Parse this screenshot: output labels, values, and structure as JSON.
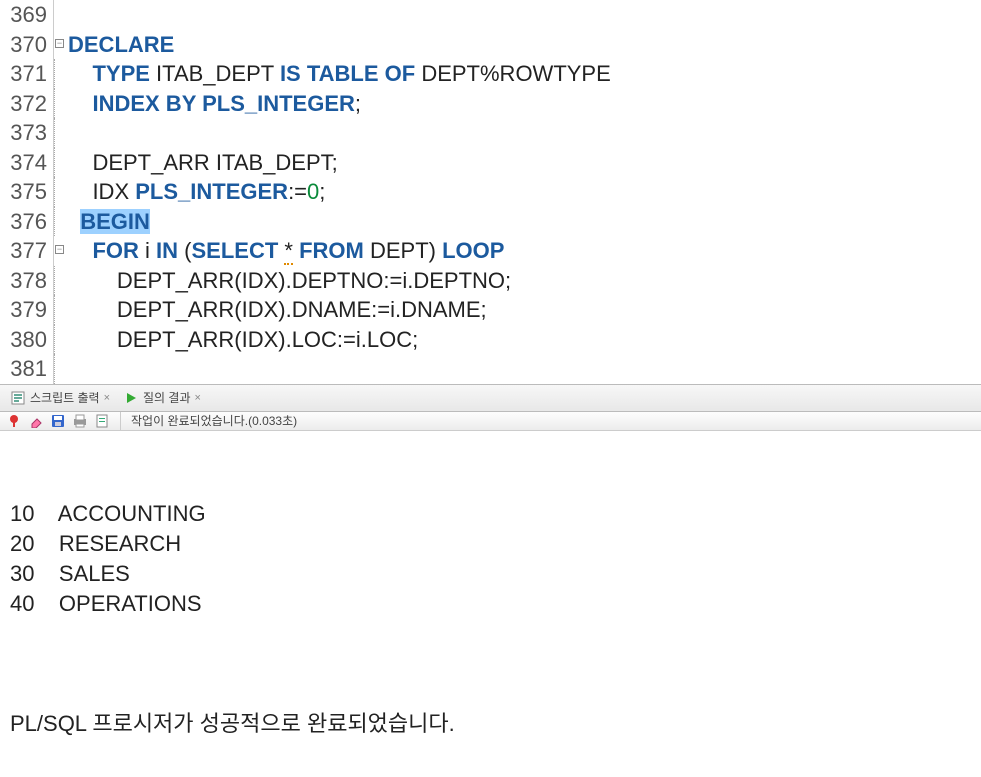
{
  "editor": {
    "lines": [
      {
        "num": "369",
        "fold": null,
        "tokens": []
      },
      {
        "num": "370",
        "fold": "minus",
        "tokens": [
          {
            "t": "kw",
            "v": "DECLARE"
          }
        ]
      },
      {
        "num": "371",
        "fold": "pipe",
        "tokens": [
          {
            "t": "txt",
            "v": "    "
          },
          {
            "t": "kw",
            "v": "TYPE"
          },
          {
            "t": "txt",
            "v": " ITAB_DEPT "
          },
          {
            "t": "kw",
            "v": "IS TABLE OF"
          },
          {
            "t": "txt",
            "v": " DEPT%ROWTYPE"
          }
        ]
      },
      {
        "num": "372",
        "fold": "pipe",
        "tokens": [
          {
            "t": "txt",
            "v": "    "
          },
          {
            "t": "kw",
            "v": "INDEX BY PLS_INTEGER"
          },
          {
            "t": "txt",
            "v": ";"
          }
        ]
      },
      {
        "num": "373",
        "fold": "pipe",
        "tokens": []
      },
      {
        "num": "374",
        "fold": "pipe",
        "tokens": [
          {
            "t": "txt",
            "v": "    DEPT_ARR ITAB_DEPT;"
          }
        ]
      },
      {
        "num": "375",
        "fold": "pipe",
        "tokens": [
          {
            "t": "txt",
            "v": "    IDX "
          },
          {
            "t": "kw",
            "v": "PLS_INTEGER"
          },
          {
            "t": "txt",
            "v": ":="
          },
          {
            "t": "num",
            "v": "0"
          },
          {
            "t": "txt",
            "v": ";"
          }
        ]
      },
      {
        "num": "376",
        "fold": "pipe",
        "tokens": [
          {
            "t": "txt",
            "v": "  "
          },
          {
            "t": "kw hl",
            "v": "BEGIN"
          }
        ]
      },
      {
        "num": "377",
        "fold": "minus",
        "tokens": [
          {
            "t": "txt",
            "v": "    "
          },
          {
            "t": "kw",
            "v": "FOR"
          },
          {
            "t": "txt",
            "v": " i "
          },
          {
            "t": "kw",
            "v": "IN"
          },
          {
            "t": "txt",
            "v": " ("
          },
          {
            "t": "kw",
            "v": "SELECT"
          },
          {
            "t": "txt",
            "v": " "
          },
          {
            "t": "txt squig",
            "v": "*"
          },
          {
            "t": "txt",
            "v": " "
          },
          {
            "t": "kw",
            "v": "FROM"
          },
          {
            "t": "txt",
            "v": " DEPT) "
          },
          {
            "t": "kw",
            "v": "LOOP"
          }
        ]
      },
      {
        "num": "378",
        "fold": "pipe",
        "tokens": [
          {
            "t": "txt",
            "v": "        DEPT_ARR(IDX).DEPTNO:=i.DEPTNO;"
          }
        ]
      },
      {
        "num": "379",
        "fold": "pipe",
        "tokens": [
          {
            "t": "txt",
            "v": "        DEPT_ARR(IDX).DNAME:=i.DNAME;"
          }
        ]
      },
      {
        "num": "380",
        "fold": "pipe",
        "tokens": [
          {
            "t": "txt",
            "v": "        DEPT_ARR(IDX).LOC:=i.LOC;"
          }
        ]
      },
      {
        "num": "381",
        "fold": "pipe",
        "tokens": []
      }
    ]
  },
  "panel": {
    "tabs": [
      {
        "icon": "script-output-icon",
        "label": "스크립트 출력",
        "active": true
      },
      {
        "icon": "query-result-icon",
        "label": "질의 결과",
        "active": false
      }
    ],
    "toolbar": {
      "pin_icon": "pin-icon",
      "erase_icon": "eraser-icon",
      "save_icon": "disk-icon",
      "print_icon": "printer-icon",
      "sql_icon": "sql-file-icon",
      "status": "작업이 완료되었습니다.(0.033초)"
    }
  },
  "output": {
    "rows": [
      {
        "a": "10",
        "b": "ACCOUNTING"
      },
      {
        "a": "20",
        "b": "RESEARCH"
      },
      {
        "a": "30",
        "b": "SALES"
      },
      {
        "a": "40",
        "b": "OPERATIONS"
      }
    ],
    "completion": "PL/SQL 프로시저가 성공적으로 완료되었습니다."
  }
}
